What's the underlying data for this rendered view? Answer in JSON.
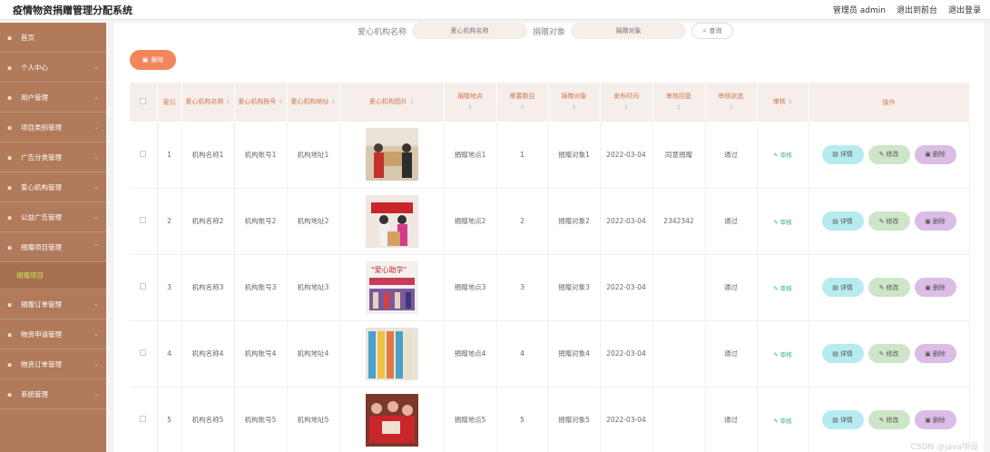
{
  "header": {
    "title": "疫情物资捐赠管理分配系统",
    "admin": "管理员 admin",
    "to_front": "退出到前台",
    "logout": "退出登录"
  },
  "sidebar": {
    "items": [
      {
        "label": "首页"
      },
      {
        "label": "个人中心"
      },
      {
        "label": "用户管理"
      },
      {
        "label": "项目类别管理"
      },
      {
        "label": "广告分类管理"
      },
      {
        "label": "爱心机构管理"
      },
      {
        "label": "公益广告管理"
      },
      {
        "label": "捐赠项目管理"
      },
      {
        "label": "捐赠项目",
        "sub": true
      },
      {
        "label": "捐赠订单管理"
      },
      {
        "label": "物资申请管理"
      },
      {
        "label": "物资订单管理"
      },
      {
        "label": "系统管理"
      }
    ]
  },
  "search": {
    "org_label": "爱心机构名称",
    "org_placeholder": "爱心机构名称",
    "target_label": "捐赠对象",
    "target_placeholder": "捐赠对象",
    "button": "查询"
  },
  "toolbar": {
    "delete_label": "删除"
  },
  "table": {
    "headers": [
      "",
      "索引",
      "爱心机构名称",
      "爱心机构账号",
      "爱心机构地址",
      "爱心机构图片",
      "捐赠地点",
      "需要数目",
      "捐赠对象",
      "发布时间",
      "审核回复",
      "审核状态",
      "审核",
      "操作"
    ],
    "rows": [
      {
        "index": "1",
        "name": "机构名称1",
        "account": "机构账号1",
        "address": "机构地址1",
        "place": "捐赠地点1",
        "num": "1",
        "target": "捐赠对象1",
        "date": "2022-03-04",
        "reply": "同意捐赠",
        "status": "通过"
      },
      {
        "index": "2",
        "name": "机构名称2",
        "account": "机构账号2",
        "address": "机构地址2",
        "place": "捐赠地点2",
        "num": "2",
        "target": "捐赠对象2",
        "date": "2022-03-04",
        "reply": "2342342",
        "status": "通过"
      },
      {
        "index": "3",
        "name": "机构名称3",
        "account": "机构账号3",
        "address": "机构地址3",
        "place": "捐赠地点3",
        "num": "3",
        "target": "捐赠对象3",
        "date": "2022-03-04",
        "reply": "",
        "status": "通过"
      },
      {
        "index": "4",
        "name": "机构名称4",
        "account": "机构账号4",
        "address": "机构地址4",
        "place": "捐赠地点4",
        "num": "4",
        "target": "捐赠对象4",
        "date": "2022-03-04",
        "reply": "",
        "status": "通过"
      },
      {
        "index": "5",
        "name": "机构名称5",
        "account": "机构账号5",
        "address": "机构地址5",
        "place": "捐赠地点5",
        "num": "5",
        "target": "捐赠对象5",
        "date": "2022-03-04",
        "reply": "",
        "status": "通过"
      }
    ],
    "review_label": "审核",
    "detail_label": "详情",
    "edit_label": "修改",
    "del_label": "删除"
  },
  "watermark": "CSDN @java毕设",
  "colors": {
    "sidebar": "#b17a5b",
    "accent": "#f1865c",
    "header_text": "#d0764f"
  }
}
